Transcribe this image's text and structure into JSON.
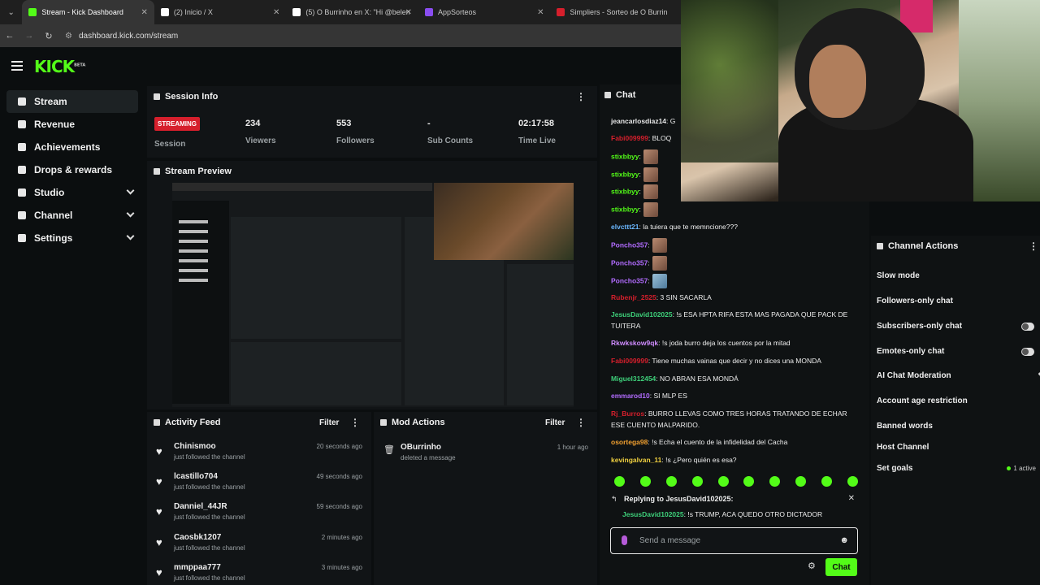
{
  "browser": {
    "tabs": [
      {
        "label": "Stream - Kick Dashboard",
        "color": "#53fc18",
        "active": true
      },
      {
        "label": "(2) Inicio / X",
        "color": "#ffffff",
        "active": false
      },
      {
        "label": "(5) O Burrinho en X: \"Hi @belen",
        "color": "#ffffff",
        "active": false
      },
      {
        "label": "AppSorteos",
        "color": "#8a4df0",
        "active": false
      },
      {
        "label": "Simpliers - Sorteo de O Burrin",
        "color": "#d61f2c",
        "active": false
      }
    ],
    "url": "dashboard.kick.com/stream"
  },
  "app": {
    "logo": "KICK",
    "logo_sup": "BETA"
  },
  "sidebar": {
    "items": [
      {
        "label": "Stream",
        "active": true,
        "expandable": false
      },
      {
        "label": "Revenue",
        "active": false,
        "expandable": false
      },
      {
        "label": "Achievements",
        "active": false,
        "expandable": false
      },
      {
        "label": "Drops & rewards",
        "active": false,
        "expandable": false
      },
      {
        "label": "Studio",
        "active": false,
        "expandable": true
      },
      {
        "label": "Channel",
        "active": false,
        "expandable": true
      },
      {
        "label": "Settings",
        "active": false,
        "expandable": true
      }
    ]
  },
  "session": {
    "title": "Session Info",
    "status": "STREAMING",
    "status_label": "Session",
    "stats": [
      {
        "value": "234",
        "label": "Viewers"
      },
      {
        "value": "553",
        "label": "Followers"
      },
      {
        "value": "-",
        "label": "Sub Counts"
      },
      {
        "value": "02:17:58",
        "label": "Time Live"
      }
    ]
  },
  "preview": {
    "title": "Stream Preview"
  },
  "activity": {
    "title": "Activity Feed",
    "filter": "Filter",
    "items": [
      {
        "name": "Chinismoo",
        "action": "just followed the channel",
        "time": "20 seconds ago"
      },
      {
        "name": "lcastillo704",
        "action": "just followed the channel",
        "time": "49 seconds ago"
      },
      {
        "name": "Danniel_44JR",
        "action": "just followed the channel",
        "time": "59 seconds ago"
      },
      {
        "name": "Caosbk1207",
        "action": "just followed the channel",
        "time": "2 minutes ago"
      },
      {
        "name": "mmppaa777",
        "action": "just followed the channel",
        "time": "3 minutes ago"
      }
    ]
  },
  "mod": {
    "title": "Mod Actions",
    "filter": "Filter",
    "items": [
      {
        "name": "OBurrinho",
        "action": "deleted a message",
        "time": "1 hour ago"
      }
    ]
  },
  "chat": {
    "title": "Chat",
    "messages": [
      {
        "user": "jeancarlosdiaz14",
        "color": "#e8e8e8",
        "text": ": G"
      },
      {
        "user": "Fabi009999",
        "color": "#d61f2c",
        "text": ": BLOQ"
      },
      {
        "user": "stixbbyy",
        "color": "#53fc18",
        "text": ":",
        "emote": "brown"
      },
      {
        "user": "stixbbyy",
        "color": "#53fc18",
        "text": ":",
        "emote": "brown"
      },
      {
        "user": "stixbbyy",
        "color": "#53fc18",
        "text": ":",
        "emote": "brown"
      },
      {
        "user": "stixbbyy",
        "color": "#53fc18",
        "text": ":",
        "emote": "brown"
      },
      {
        "user": "elvcttt21",
        "color": "#6ab7ff",
        "text": ": la tuiera que te memncione???"
      },
      {
        "user": "Poncho357",
        "color": "#b26cff",
        "text": ":",
        "emote": "brown"
      },
      {
        "user": "Poncho357",
        "color": "#b26cff",
        "text": ":",
        "emote": "brown"
      },
      {
        "user": "Poncho357",
        "color": "#b26cff",
        "text": ":",
        "emote": "blue"
      },
      {
        "user": "Rubenjr_2525",
        "color": "#d61f2c",
        "text": ": 3 SIN SACARLA"
      },
      {
        "user": "JesusDavid102025",
        "color": "#3ed07a",
        "text": ": !s ESA HPTA RIFA ESTA MAS PAGADA QUE PACK DE TUITERA"
      },
      {
        "user": "Rkwkskow9qk",
        "color": "#d08cff",
        "text": ": !s joda burro deja los cuentos por la mitad"
      },
      {
        "user": "Fabi009999",
        "color": "#d61f2c",
        "text": ": Tiene muchas vainas que decir y no dices una MONDA"
      },
      {
        "user": "Miguel312454",
        "color": "#3ed07a",
        "text": ": NO ABRAN ESA MONDÁ"
      },
      {
        "user": "emmarod10",
        "color": "#b26cff",
        "text": ": SI MLP ES"
      },
      {
        "user": "Rj_Burros",
        "color": "#d61f2c",
        "text": ": BURRO LLEVAS COMO TRES HORAS TRATANDO DE ECHAR ESE CUENTO MALPARIDO."
      },
      {
        "user": "osortega98",
        "color": "#f0a030",
        "text": ": !s Echa el cuento de la infidelidad del Cacha"
      },
      {
        "user": "kevingalvan_11",
        "color": "#f0d040",
        "text": ": !s ¿Pero quién es esa?"
      }
    ],
    "reply_title": "Replying to JesusDavid102025:",
    "reply_user": "JesusDavid102025",
    "reply_text": ": !s TRUMP, ACA QUEDO OTRO DICTADOR",
    "input_placeholder": "Send a message",
    "send_label": "Chat"
  },
  "channel_actions": {
    "title": "Channel Actions",
    "items": [
      {
        "label": "Slow mode",
        "control": "arrow"
      },
      {
        "label": "Followers-only chat",
        "control": "arrow"
      },
      {
        "label": "Subscribers-only chat",
        "control": "toggle"
      },
      {
        "label": "Emotes-only chat",
        "control": "toggle"
      },
      {
        "label": "AI Chat Moderation",
        "control": "edit"
      },
      {
        "label": "Account age restriction",
        "control": "arrow"
      },
      {
        "label": "Banned words",
        "control": "arrow"
      },
      {
        "label": "Host Channel",
        "control": "none"
      },
      {
        "label": "Set goals",
        "control": "status"
      }
    ],
    "goals_status": "1 active"
  },
  "colors": {
    "accent": "#53fc18",
    "live": "#d61f2c"
  }
}
